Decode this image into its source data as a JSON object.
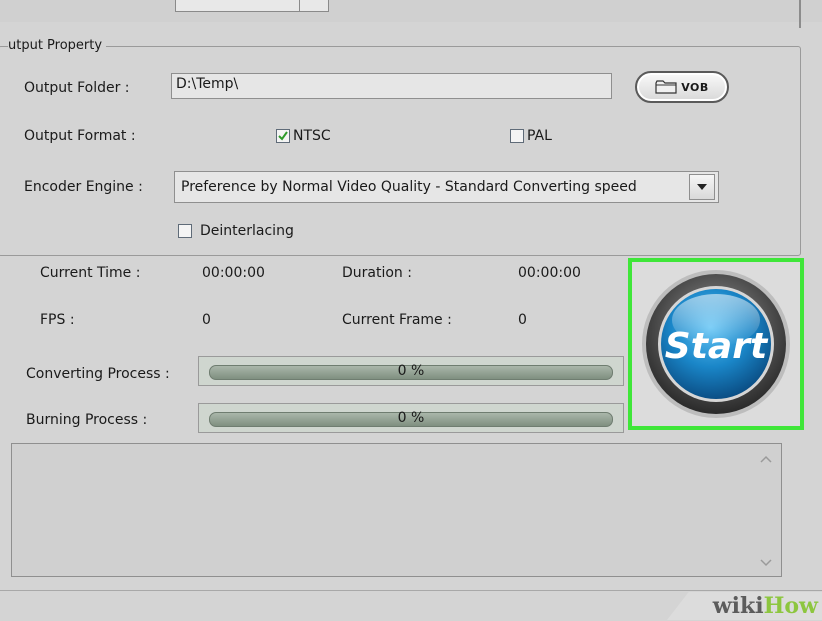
{
  "output_property": {
    "legend": "utput Property",
    "output_folder_label": "Output Folder :",
    "output_folder_value": "D:\\Temp\\",
    "vob_button_label": "VOB",
    "output_format_label": "Output Format :",
    "ntsc_label": "NTSC",
    "ntsc_checked": true,
    "pal_label": "PAL",
    "pal_checked": false,
    "encoder_engine_label": "Encoder Engine :",
    "encoder_engine_value": "Preference by Normal Video Quality - Standard Converting speed",
    "deinterlacing_label": "Deinterlacing",
    "deinterlacing_checked": false
  },
  "status": {
    "current_time_label": "Current Time :",
    "current_time_value": "00:00:00",
    "duration_label": "Duration :",
    "duration_value": "00:00:00",
    "fps_label": "FPS :",
    "fps_value": "0",
    "current_frame_label": "Current Frame :",
    "current_frame_value": "0",
    "converting_label": "Converting Process :",
    "converting_text": "0 %",
    "converting_progress": 0,
    "burning_label": "Burning Process :",
    "burning_text": "0 %",
    "burning_progress": 0
  },
  "start_button": {
    "label": "Start",
    "highlight_color": "#3fe639"
  },
  "watermark": {
    "part1": "wiki",
    "part2": "How"
  },
  "icons": {
    "folder": "folder-icon",
    "checkmark": "checkmark-icon",
    "dropdown": "chevron-down-icon",
    "scroll_up": "chevron-up-icon",
    "scroll_down": "chevron-down-icon"
  }
}
